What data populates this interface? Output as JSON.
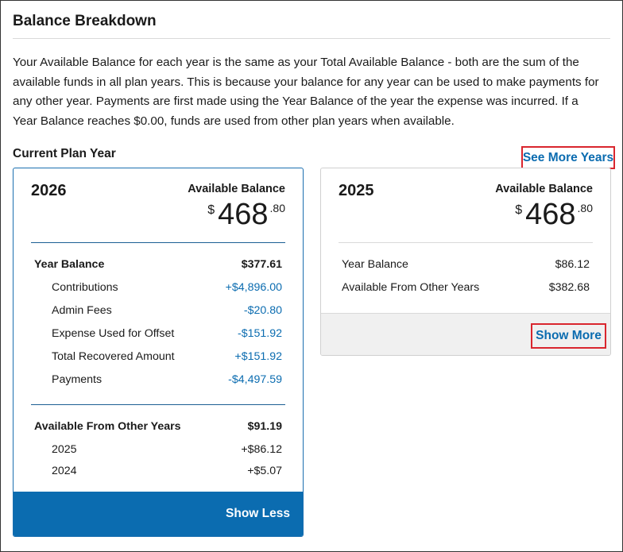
{
  "page": {
    "title": "Balance Breakdown",
    "intro": "Your Available Balance for each year is the same as your Total Available Balance - both are the sum of the available funds in all plan years. This is because your balance for any year can be used to make payments for any other year. Payments are first made using the Year Balance of the year the expense was incurred. If a Year Balance reaches $0.00, funds are used from other plan years when available.",
    "current_plan_year_label": "Current Plan Year",
    "see_more_years": "See More Years"
  },
  "cards": {
    "current": {
      "year": "2026",
      "available_label": "Available Balance",
      "currency": "$",
      "amount_whole": "468",
      "amount_cents": ".80",
      "year_balance": {
        "label": "Year Balance",
        "value": "$377.61"
      },
      "details": [
        {
          "label": "Contributions",
          "value": "+$4,896.00"
        },
        {
          "label": "Admin Fees",
          "value": "-$20.80"
        },
        {
          "label": "Expense Used for Offset",
          "value": "-$151.92"
        },
        {
          "label": "Total Recovered Amount",
          "value": "+$151.92"
        },
        {
          "label": "Payments",
          "value": "-$4,497.59"
        }
      ],
      "other_years": {
        "label": "Available From Other Years",
        "value": "$91.19"
      },
      "other_year_items": [
        {
          "label": "2025",
          "value": "+$86.12"
        },
        {
          "label": "2024",
          "value": "+$5.07"
        }
      ],
      "show_less": "Show Less"
    },
    "previous": {
      "year": "2025",
      "available_label": "Available Balance",
      "currency": "$",
      "amount_whole": "468",
      "amount_cents": ".80",
      "rows": [
        {
          "label": "Year Balance",
          "value": "$86.12"
        },
        {
          "label": "Available From Other Years",
          "value": "$382.68"
        }
      ],
      "show_more": "Show More"
    }
  },
  "colors": {
    "link": "#0b6cb0",
    "highlight_border": "#d9262e",
    "card_border_active": "#1b6fb0",
    "button_bg": "#0b6cb0"
  }
}
